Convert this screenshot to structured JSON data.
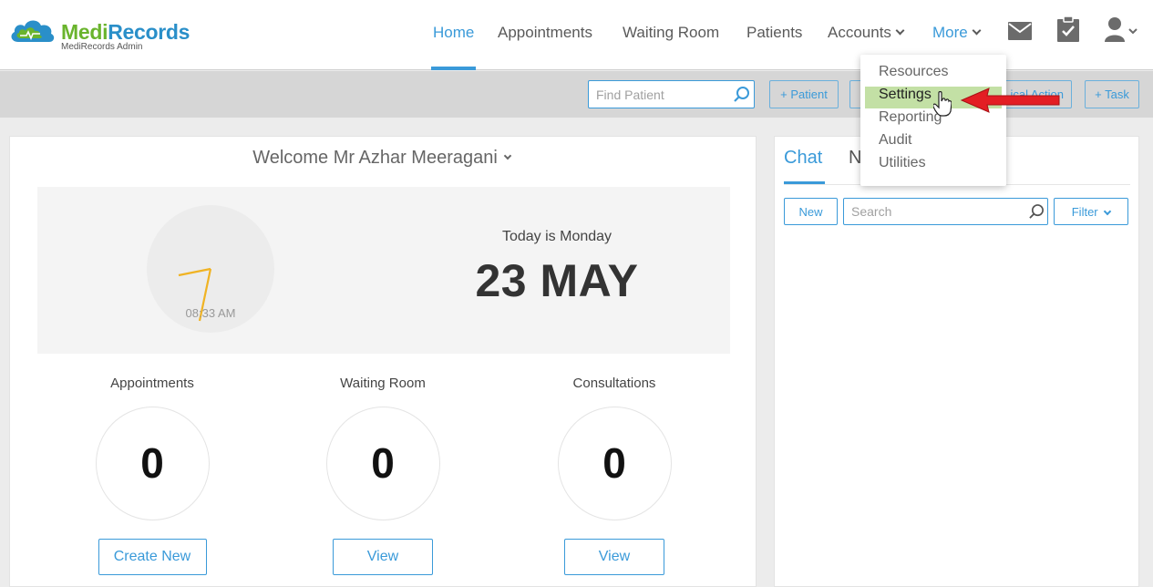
{
  "brand": {
    "name_part1": "Medi",
    "name_part2": "Records",
    "subtitle": "MediRecords Admin",
    "cloud_color": "#2a8fc9",
    "green": "#6ab42d"
  },
  "nav": {
    "items": [
      {
        "label": "Home",
        "active": true
      },
      {
        "label": "Appointments"
      },
      {
        "label": "Waiting Room"
      },
      {
        "label": "Patients"
      },
      {
        "label": "Accounts",
        "has_dropdown": true
      },
      {
        "label": "More",
        "has_dropdown": true,
        "open": true
      }
    ],
    "icons": [
      "mail-icon",
      "clipboard-check-icon",
      "user-icon"
    ]
  },
  "toolbar": {
    "find_placeholder": "Find Patient",
    "buttons": [
      {
        "label": "+ Patient"
      },
      {
        "label": ""
      },
      {
        "label": "..ical Action"
      },
      {
        "label": "+ Task"
      }
    ]
  },
  "more_menu": {
    "items": [
      {
        "label": "Resources"
      },
      {
        "label": "Settings",
        "highlighted": true
      },
      {
        "label": "Reporting"
      },
      {
        "label": "Audit"
      },
      {
        "label": "Utilities"
      }
    ]
  },
  "dashboard": {
    "welcome": "Welcome Mr Azhar Meeragani",
    "clock_time": "08:33 AM",
    "today_text": "Today is Monday",
    "date": "23 MAY",
    "stats": [
      {
        "label": "Appointments",
        "value": "0",
        "button": "Create New"
      },
      {
        "label": "Waiting Room",
        "value": "0",
        "button": "View"
      },
      {
        "label": "Consultations",
        "value": "0",
        "button": "View"
      }
    ]
  },
  "side": {
    "tab_chat": "Chat",
    "tab_second": "N",
    "new_button": "New",
    "search_placeholder": "Search",
    "filter_button": "Filter"
  },
  "colors": {
    "accent": "#3a9ad9",
    "highlight": "#c3e0a5",
    "annotation_arrow": "#e31e24",
    "clock_hand": "#f0b323"
  }
}
